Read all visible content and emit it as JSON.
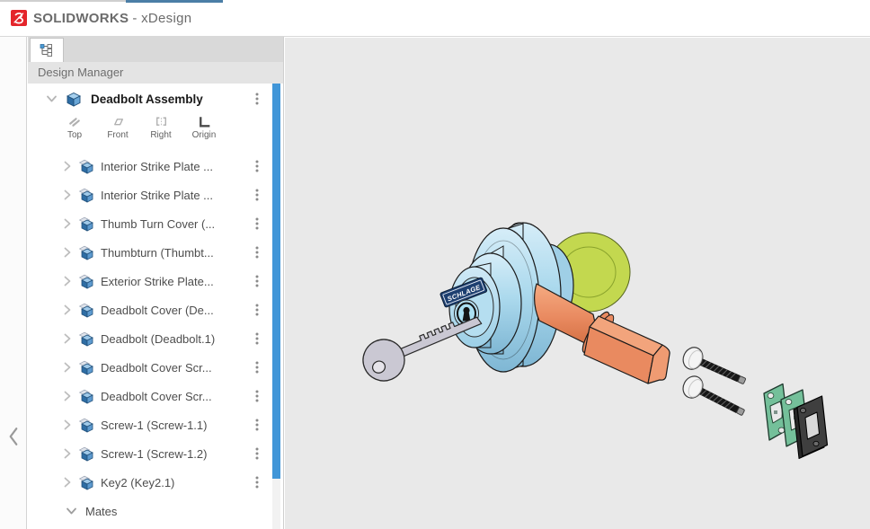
{
  "header": {
    "brand": "SOLIDWORKS",
    "app": "- xDesign"
  },
  "panel": {
    "tab_title": "Design Manager",
    "assembly_name": "Deadbolt Assembly",
    "planes": [
      {
        "label": "Top"
      },
      {
        "label": "Front"
      },
      {
        "label": "Right"
      },
      {
        "label": "Origin"
      }
    ],
    "components": [
      "Interior Strike Plate ...",
      "Interior Strike Plate ...",
      "Thumb Turn Cover (...",
      "Thumbturn (Thumbt...",
      "Exterior Strike Plate...",
      "Deadbolt Cover (De...",
      "Deadbolt (Deadbolt.1)",
      "Deadbolt Cover Scr...",
      "Deadbolt Cover Scr...",
      "Screw-1 (Screw-1.1)",
      "Screw-1 (Screw-1.2)",
      "Key2 (Key2.1)"
    ],
    "mates_label": "Mates"
  },
  "viewport": {
    "brand_label": "SCHLAGE"
  },
  "colors": {
    "accent-blue": "#4196d8",
    "logo-red": "#e4252b",
    "model-blue": "#abd9ed",
    "model-orange": "#e98a60",
    "model-green": "#74c09a",
    "model-yellow": "#c3d84f",
    "model-key-gray": "#cac8d3",
    "badge-navy": "#1d3f70",
    "plate-dark": "#3f3f3f"
  }
}
